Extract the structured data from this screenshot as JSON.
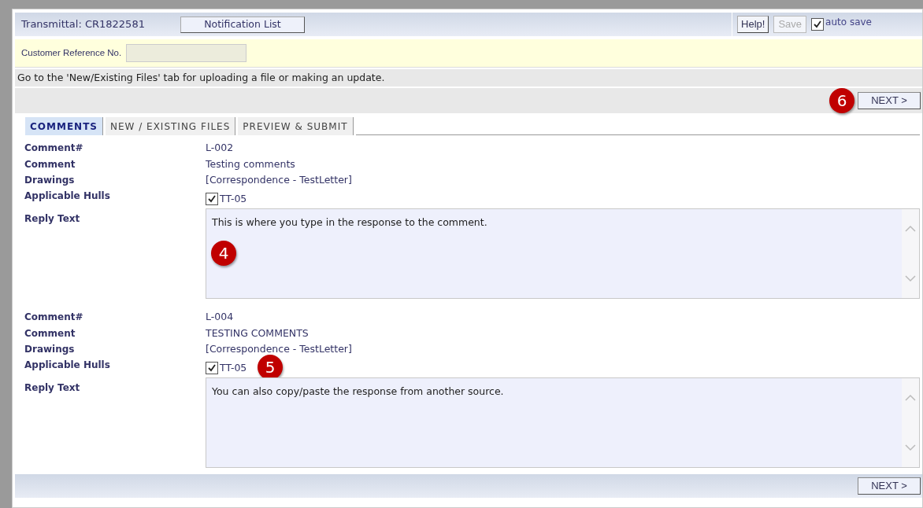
{
  "header": {
    "transmittal": "Transmittal: CR1822581",
    "notification_button": "Notification List",
    "help_button": "Help!",
    "save_button": {
      "label": "Save",
      "disabled": true
    },
    "auto_save": {
      "label": "auto save",
      "checked": true
    }
  },
  "customer_reference": {
    "label": "Customer Reference No."
  },
  "message": "Go to the 'New/Existing Files' tab for uploading a file or making an update.",
  "top_next": {
    "label": "NEXT >",
    "callout": "6"
  },
  "tabs": [
    {
      "label": "COMMENTS",
      "selected": true
    },
    {
      "label": "NEW / EXISTING FILES",
      "selected": false
    },
    {
      "label": "PREVIEW & SUBMIT",
      "selected": false
    }
  ],
  "comments": [
    {
      "labels": {
        "number": "Comment#",
        "comment": "Comment",
        "drawings": "Drawings",
        "hulls": "Applicable Hulls",
        "reply": "Reply Text"
      },
      "number": "L-002",
      "comment": "Testing comments",
      "drawings": "[Correspondence - TestLetter]",
      "hulls": [
        {
          "label": "TT-05",
          "checked": true
        }
      ],
      "reply_text": "This is where you type in the response to the comment.",
      "callout": {
        "text": "4",
        "kind": "reply"
      }
    },
    {
      "labels": {
        "number": "Comment#",
        "comment": "Comment",
        "drawings": "Drawings",
        "hulls": "Applicable Hulls",
        "reply": "Reply Text"
      },
      "number": "L-004",
      "comment": "TESTING COMMENTS",
      "drawings": "[Correspondence - TestLetter]",
      "hulls": [
        {
          "label": "TT-05",
          "checked": true
        }
      ],
      "reply_text": "You can also copy/paste the response from another source.",
      "callout": {
        "text": "5",
        "kind": "hulls"
      }
    }
  ],
  "bottom_next": {
    "label": "NEXT >"
  }
}
